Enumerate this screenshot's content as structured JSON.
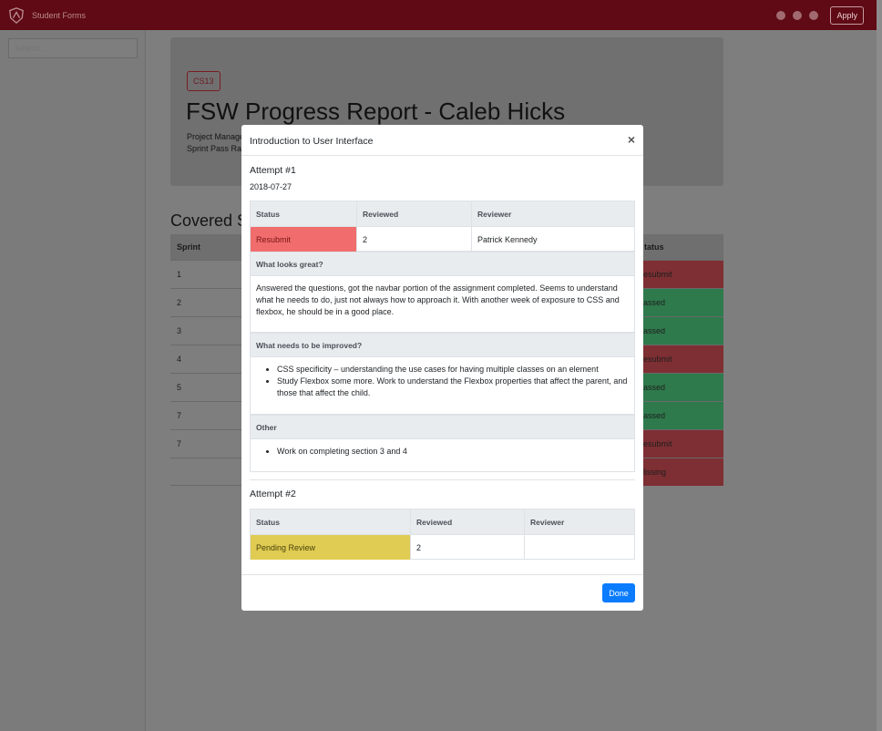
{
  "navbar": {
    "brand": "Student Forms",
    "apply_label": "Apply"
  },
  "sidebar": {
    "search_placeholder": "Search..."
  },
  "background": {
    "course_badge": "CS13",
    "report_title": "FSW Progress Report - Caleb Hicks",
    "meta_lines": [
      "Project Manage",
      "Sprint Pass Rat"
    ],
    "covered_title": "Covered S",
    "table_headers": [
      "Sprint",
      "tatus"
    ],
    "rows": [
      {
        "sprint": "1",
        "status": "esubmit",
        "state": "fail"
      },
      {
        "sprint": "2",
        "status": "assed",
        "state": "pass"
      },
      {
        "sprint": "3",
        "status": "assed",
        "state": "pass"
      },
      {
        "sprint": "4",
        "status": "esubmit",
        "state": "fail"
      },
      {
        "sprint": "5",
        "status": "assed",
        "state": "pass"
      },
      {
        "sprint": "7",
        "status": "assed",
        "state": "pass"
      },
      {
        "sprint": "7",
        "status": "esubmit",
        "state": "fail"
      },
      {
        "sprint": "",
        "status": "lissing",
        "state": "fail"
      }
    ]
  },
  "modal": {
    "title": "Introduction to User Interface",
    "close_symbol": "×",
    "attempt1": {
      "title": "Attempt #1",
      "date": "2018-07-27",
      "headers": [
        "Status",
        "Reviewed",
        "Reviewer"
      ],
      "status": "Resubmit",
      "reviewed": "2",
      "reviewer": "Patrick Kennedy",
      "what_looks_great_label": "What looks great?",
      "what_looks_great_text": "Answered the questions, got the navbar portion of the assignment completed. Seems to understand what he needs to do, just not always how to approach it. With another week of exposure to CSS and flexbox, he should be in a good place.",
      "needs_improvement_label": "What needs to be improved?",
      "needs_improvement_items": [
        "CSS specificity – understanding the use cases for having multiple classes on an element",
        "Study Flexbox some more. Work to understand the Flexbox properties that affect the parent, and those that affect the child."
      ],
      "other_label": "Other",
      "other_items": [
        "Work on completing section 3 and 4"
      ]
    },
    "attempt2": {
      "title": "Attempt #2",
      "headers": [
        "Status",
        "Reviewed",
        "Reviewer"
      ],
      "status": "Pending Review",
      "reviewed": "2",
      "reviewer": ""
    },
    "done_label": "Done"
  },
  "colors": {
    "navbar": "#5f0a14",
    "resubmit": "#f16d6d",
    "pending": "#e0cc52",
    "done_button": "#0b7cff",
    "bg_pass": "#2e7a4c",
    "bg_fail": "#7e2f33"
  }
}
